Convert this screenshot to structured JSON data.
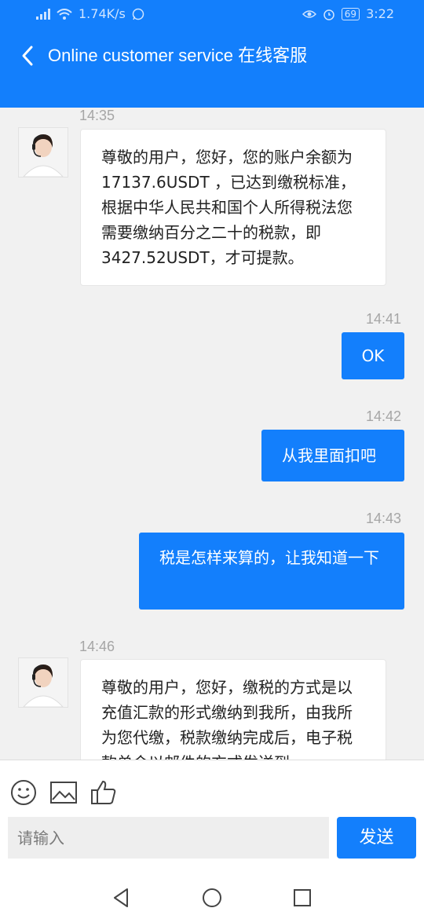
{
  "status_bar": {
    "net_speed": "1.74K/s",
    "battery": "69",
    "time": "3:22"
  },
  "header": {
    "title": "Online customer service 在线客服"
  },
  "messages": [
    {
      "time": "14:35",
      "sender": "agent",
      "text": "尊敬的用户，您好，您的账户余额为 17137.6USDT ，已达到缴税标准，根据中华人民共和国个人所得税法您需要缴纳百分之二十的税款，即3427.52USDT，才可提款。"
    },
    {
      "time": "14:41",
      "sender": "user",
      "text": "OK"
    },
    {
      "time": "14:42",
      "sender": "user",
      "text": "从我里面扣吧"
    },
    {
      "time": "14:43",
      "sender": "user",
      "text": "税是怎样来算的，让我知道一下"
    },
    {
      "time": "14:46",
      "sender": "agent",
      "text": "尊敬的用户，您好，缴税的方式是以充值汇款的形式缴纳到我所，由我所为您代缴，税款缴纳完成后，电子税款单会以邮件的方式发送到"
    }
  ],
  "composer": {
    "placeholder": "请输入",
    "send_label": "发送"
  },
  "icons": {
    "emoji": "smiley-face-icon",
    "image": "image-icon",
    "like": "thumbs-up-icon"
  },
  "colors": {
    "accent": "#137ffc",
    "background": "#f1f1f1"
  }
}
